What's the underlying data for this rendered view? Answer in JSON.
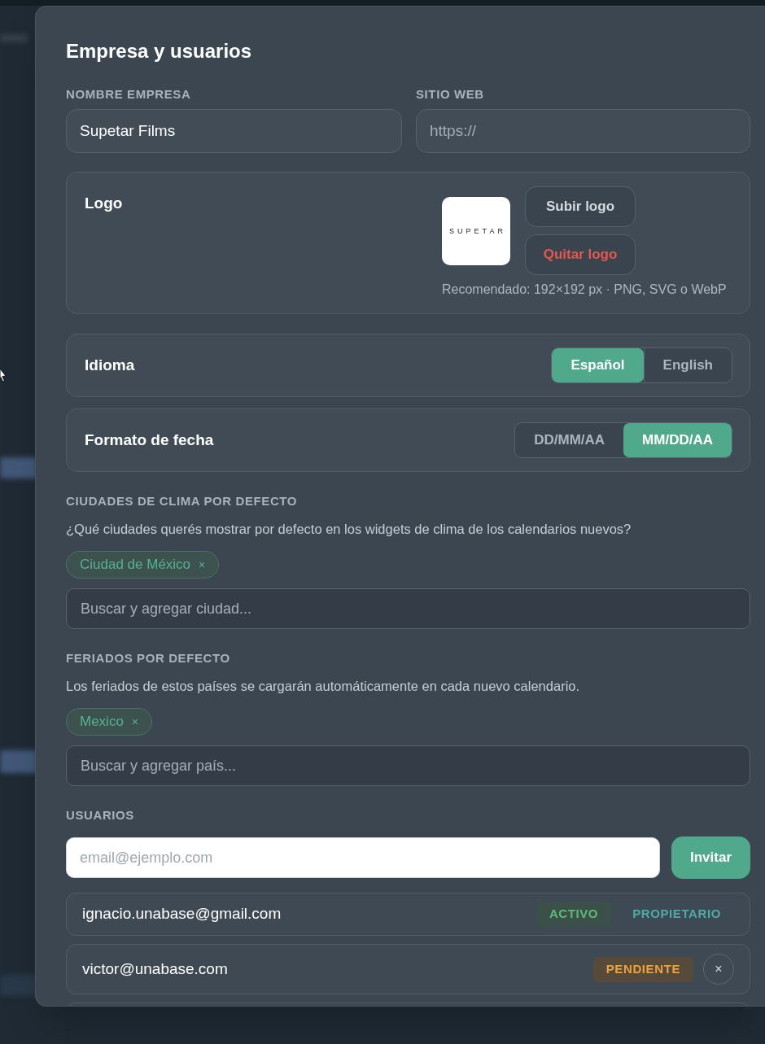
{
  "dialog": {
    "title": "Empresa y usuarios"
  },
  "fields": [
    {
      "label": "NOMBRE EMPRESA",
      "value": "Supetar Films"
    },
    {
      "label": "SITIO WEB",
      "placeholder": "https://"
    }
  ],
  "logo": {
    "label": "Logo",
    "wordmark": "SUPETAR",
    "buttons": [
      {
        "label": "Subir logo",
        "kind": "default"
      },
      {
        "label": "Quitar logo",
        "kind": "danger"
      }
    ],
    "hint": "Recomendado: 192×192 px · PNG, SVG o WebP"
  },
  "settings": [
    {
      "label": "Idioma",
      "options": [
        {
          "label": "Español",
          "selected": true
        },
        {
          "label": "English",
          "selected": false
        }
      ]
    },
    {
      "label": "Formato de fecha",
      "options": [
        {
          "label": "DD/MM/AA",
          "selected": false
        },
        {
          "label": "MM/DD/AA",
          "selected": true
        }
      ]
    }
  ],
  "tag_sections": [
    {
      "heading": "CIUDADES DE CLIMA POR DEFECTO",
      "description": "¿Qué ciudades querés mostrar por defecto en los widgets de clima de los calendarios nuevos?",
      "tags": [
        {
          "label": "Ciudad de México",
          "remove": "×"
        }
      ],
      "search": {
        "placeholder": "Buscar y agregar ciudad..."
      }
    },
    {
      "heading": "FERIADOS POR DEFECTO",
      "description": "Los feriados de estos países se cargarán automáticamente en cada nuevo calendario.",
      "tags": [
        {
          "label": "Mexico",
          "remove": "×"
        }
      ],
      "search": {
        "placeholder": "Buscar y agregar país..."
      }
    }
  ],
  "users": {
    "heading": "USUARIOS",
    "invite": {
      "placeholder": "email@ejemplo.com",
      "button": "Invitar"
    },
    "rows": [
      {
        "email": "ignacio.unabase@gmail.com",
        "badges": [
          {
            "label": "ACTIVO",
            "kind": "active"
          },
          {
            "label": "PROPIETARIO",
            "kind": "owner"
          }
        ]
      },
      {
        "email": "victor@unabase.com",
        "badges": [
          {
            "label": "PENDIENTE",
            "kind": "pending"
          }
        ],
        "remove": "×"
      }
    ]
  }
}
